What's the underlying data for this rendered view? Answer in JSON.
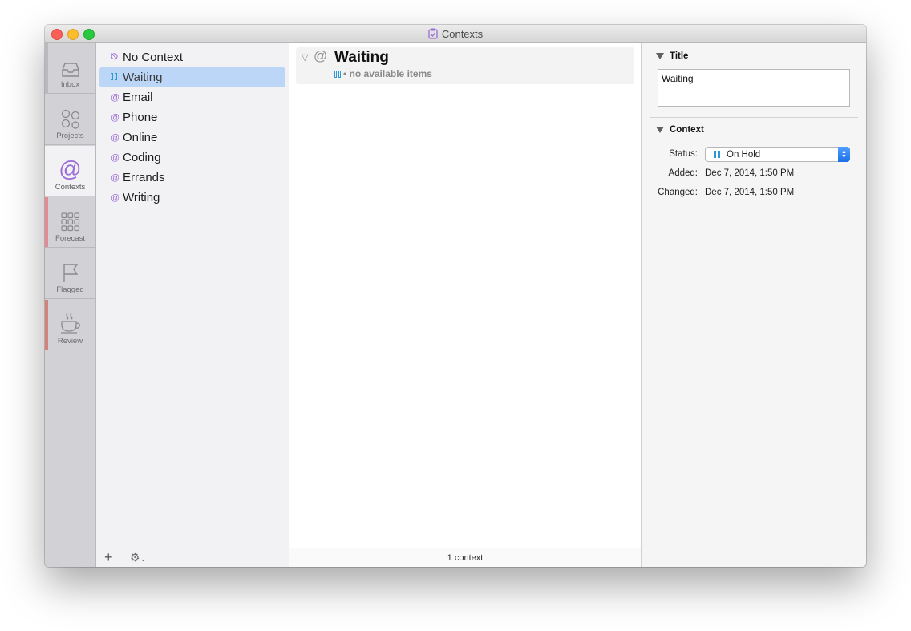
{
  "window": {
    "title": "Contexts"
  },
  "perspectives": [
    {
      "label": "Inbox",
      "icon": "inbox-icon"
    },
    {
      "label": "Projects",
      "icon": "projects-icon"
    },
    {
      "label": "Contexts",
      "icon": "contexts-icon",
      "active": true
    },
    {
      "label": "Forecast",
      "icon": "forecast-icon"
    },
    {
      "label": "Flagged",
      "icon": "flag-icon"
    },
    {
      "label": "Review",
      "icon": "review-icon"
    }
  ],
  "contexts": [
    {
      "label": "No Context",
      "icon": "no-context-icon"
    },
    {
      "label": "Waiting",
      "icon": "on-hold-icon",
      "selected": true
    },
    {
      "label": "Email",
      "icon": "at-icon"
    },
    {
      "label": "Phone",
      "icon": "at-icon"
    },
    {
      "label": "Online",
      "icon": "at-icon"
    },
    {
      "label": "Coding",
      "icon": "at-icon"
    },
    {
      "label": "Errands",
      "icon": "at-icon"
    },
    {
      "label": "Writing",
      "icon": "at-icon"
    }
  ],
  "outline": {
    "row_title": "Waiting",
    "row_subtitle": "• no available items",
    "footer": "1 context"
  },
  "inspector": {
    "title_section": "Title",
    "title_value": "Waiting",
    "context_section": "Context",
    "status_label": "Status:",
    "status_value": "On Hold",
    "added_label": "Added:",
    "added_value": "Dec 7, 2014, 1:50 PM",
    "changed_label": "Changed:",
    "changed_value": "Dec 7, 2014, 1:50 PM"
  },
  "colors": {
    "accent_purple": "#9b6dd6",
    "selection": "#bcd6f7",
    "on_hold_blue": "#2b99d6",
    "forecast_stripe": "#e58a93",
    "review_stripe": "#d3827a"
  }
}
